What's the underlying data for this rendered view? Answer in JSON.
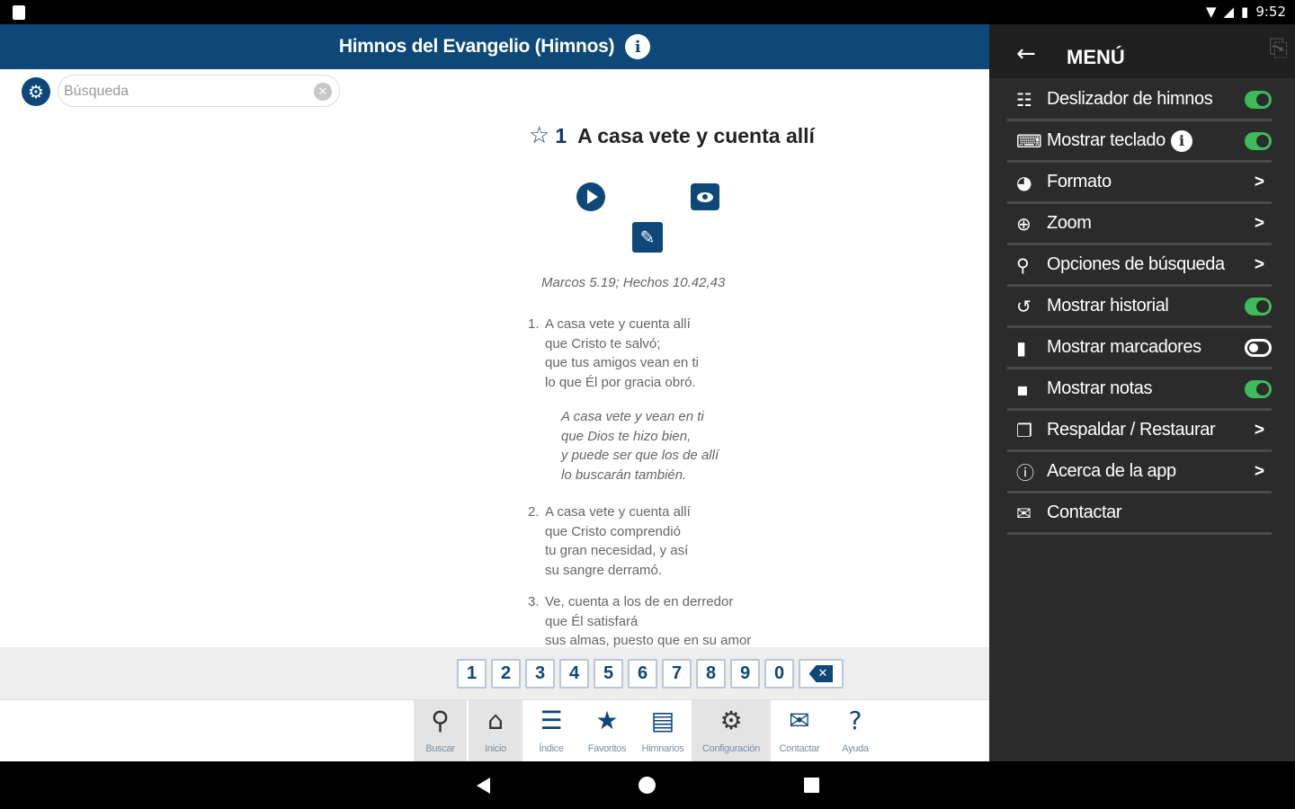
{
  "status_bar": {
    "time": "9:52"
  },
  "app_bar": {
    "title": "Himnos del Evangelio (Himnos)",
    "info_icon": "info-icon"
  },
  "search": {
    "placeholder": "Búsqueda",
    "value": ""
  },
  "hymn": {
    "number": "1",
    "title": "A casa vete y cuenta allí",
    "reference": "Marcos 5.19; Hechos 10.42,43",
    "verses": [
      {
        "number": "1.",
        "lines": [
          "A casa vete y cuenta allí",
          "que Cristo te salvó;",
          "que tus amigos vean en ti",
          "lo que Él por gracia obró."
        ]
      },
      {
        "number": "2.",
        "lines": [
          "A casa vete y cuenta allí",
          "que Cristo comprendió",
          "tu gran necesidad, y así",
          "su sangre derramó."
        ]
      },
      {
        "number": "3.",
        "lines": [
          "Ve, cuenta a los de en derredor",
          "que Él satisfará",
          "sus almas, puesto que en su amor"
        ]
      }
    ],
    "chorus": [
      "A casa vete y vean en ti",
      "que Dios te hizo bien,",
      "y puede ser que los de allí",
      "lo buscarán también."
    ]
  },
  "keypad": {
    "keys": [
      "1",
      "2",
      "3",
      "4",
      "5",
      "6",
      "7",
      "8",
      "9",
      "0"
    ],
    "backspace_label": "⌫"
  },
  "tabs": [
    {
      "label": "Buscar",
      "icon": "search-icon"
    },
    {
      "label": "Inicio",
      "icon": "home-icon"
    },
    {
      "label": "Índice",
      "icon": "list-icon"
    },
    {
      "label": "Favoritos",
      "icon": "star-icon"
    },
    {
      "label": "Himnarios",
      "icon": "book-icon"
    },
    {
      "label": "Configuración",
      "icon": "gear-icon"
    },
    {
      "label": "Contactar",
      "icon": "envelope-icon"
    },
    {
      "label": "Ayuda",
      "icon": "help-icon"
    }
  ],
  "drawer": {
    "title": "MENÚ",
    "items": [
      {
        "label": "Deslizador de himnos",
        "icon": "slider-icon",
        "control": "toggle-on"
      },
      {
        "label": "Mostrar teclado",
        "icon": "keyboard-icon",
        "control": "toggle-on"
      },
      {
        "label": "Formato",
        "icon": "palette-icon",
        "control": ">"
      },
      {
        "label": "Zoom",
        "icon": "zoom-icon",
        "control": ">"
      },
      {
        "label": "Opciones de búsqueda",
        "icon": "search-icon",
        "control": ">"
      },
      {
        "label": "Mostrar historial",
        "icon": "history-icon",
        "control": "toggle-on"
      },
      {
        "label": "Mostrar marcadores",
        "icon": "bookmark-icon",
        "control": "toggle-off"
      },
      {
        "label": "Mostrar notas",
        "icon": "note-icon",
        "control": "toggle-on"
      },
      {
        "label": "Respaldar / Restaurar",
        "icon": "backup-icon",
        "control": ">"
      },
      {
        "label": "Acerca de la app",
        "icon": "info-icon",
        "control": ">"
      },
      {
        "label": "Contactar",
        "icon": "envelope-icon",
        "control": ""
      }
    ]
  },
  "colors": {
    "primary": "#0d4878",
    "drawer_bg": "#2b2b2b",
    "toggle_on": "#3dba5a"
  }
}
